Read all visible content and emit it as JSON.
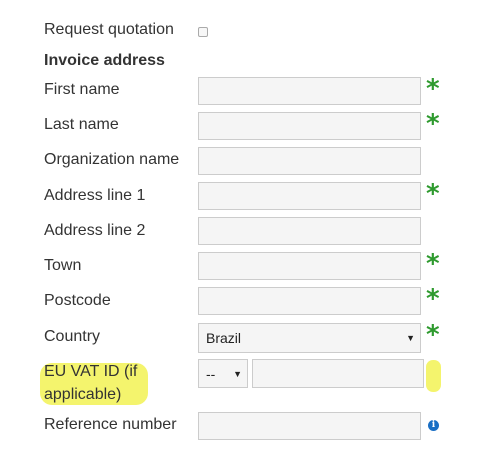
{
  "request_quotation": {
    "label": "Request quotation"
  },
  "invoice_address": {
    "heading": "Invoice address",
    "first_name_label": "First name",
    "last_name_label": "Last name",
    "organization_label": "Organization name",
    "address1_label": "Address line 1",
    "address2_label": "Address line 2",
    "town_label": "Town",
    "postcode_label": "Postcode",
    "country_label": "Country",
    "country_value": "Brazil",
    "vat_label_line1": "EU VAT ID (if",
    "vat_label_line2": "applicable)",
    "vat_prefix_value": "--",
    "reference_label": "Reference number",
    "required_marker": "*",
    "info_glyph": "i"
  },
  "colors": {
    "required": "#2e9a2e",
    "highlight": "#f0f03c",
    "info": "#1a6fc4"
  }
}
